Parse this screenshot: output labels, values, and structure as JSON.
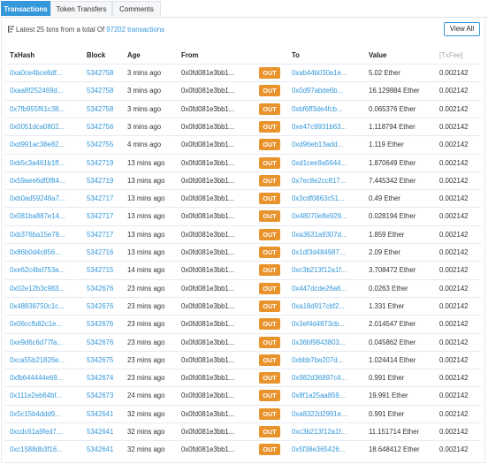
{
  "tabs": [
    {
      "label": "Transactions"
    },
    {
      "label": "Token Transfers"
    },
    {
      "label": "Comments"
    }
  ],
  "summary": {
    "prefix": "Latest 25 txns from a total Of",
    "total_link": "97202 transactions",
    "sort_icon": "sort-amount-icon"
  },
  "view_all_label": "View All",
  "columns": {
    "txhash": "TxHash",
    "block": "Block",
    "age": "Age",
    "from": "From",
    "to": "To",
    "value": "Value",
    "txfee": "[TxFee]"
  },
  "colors": {
    "accent": "#3498db",
    "out_badge": "#e8932c"
  },
  "rows": [
    {
      "hash": "0xa0ce4bce8df...",
      "block": "5342758",
      "age": "3 mins ago",
      "from": "0x0fd081e3bb1...",
      "dir": "OUT",
      "to": "0xab44b030a1e...",
      "value": "5.02 Ether",
      "fee": "0.002142"
    },
    {
      "hash": "0xaa8f252469d...",
      "block": "5342758",
      "age": "3 mins ago",
      "from": "0x0fd081e3bb1...",
      "dir": "OUT",
      "to": "0x0d97abde6b...",
      "value": "16.129884 Ether",
      "fee": "0.002142"
    },
    {
      "hash": "0x7fb955f61c38...",
      "block": "5342758",
      "age": "3 mins ago",
      "from": "0x0fd081e3bb1...",
      "dir": "OUT",
      "to": "0xbf6ff3de4fcb...",
      "value": "0.065376 Ether",
      "fee": "0.002142"
    },
    {
      "hash": "0x0051dca0802...",
      "block": "5342756",
      "age": "3 mins ago",
      "from": "0x0fd081e3bb1...",
      "dir": "OUT",
      "to": "0xe47c9931b63...",
      "value": "1.118794 Ether",
      "fee": "0.002142"
    },
    {
      "hash": "0xd991ac38e82...",
      "block": "5342755",
      "age": "4 mins ago",
      "from": "0x0fd081e3bb1...",
      "dir": "OUT",
      "to": "0xd96eb13add...",
      "value": "1.119 Ether",
      "fee": "0.002142"
    },
    {
      "hash": "0xb5c3a461b1ff...",
      "block": "5342719",
      "age": "13 mins ago",
      "from": "0x0fd081e3bb1...",
      "dir": "OUT",
      "to": "0xd1cee9a5644...",
      "value": "1.870649 Ether",
      "fee": "0.002142"
    },
    {
      "hash": "0x59aee6df0f84...",
      "block": "5342719",
      "age": "13 mins ago",
      "from": "0x0fd081e3bb1...",
      "dir": "OUT",
      "to": "0x7ec8e2cc817...",
      "value": "7.445342 Ether",
      "fee": "0.002142"
    },
    {
      "hash": "0xb0ad59248a7...",
      "block": "5342717",
      "age": "13 mins ago",
      "from": "0x0fd081e3bb1...",
      "dir": "OUT",
      "to": "0x3cdf0863c51...",
      "value": "0.49 Ether",
      "fee": "0.002142"
    },
    {
      "hash": "0x081ba887e14...",
      "block": "5342717",
      "age": "13 mins ago",
      "from": "0x0fd081e3bb1...",
      "dir": "OUT",
      "to": "0x48070e8e929...",
      "value": "0.028194 Ether",
      "fee": "0.002142"
    },
    {
      "hash": "0xb376ba15e78...",
      "block": "5342717",
      "age": "13 mins ago",
      "from": "0x0fd081e3bb1...",
      "dir": "OUT",
      "to": "0xa3631a9307d...",
      "value": "1.859 Ether",
      "fee": "0.002142"
    },
    {
      "hash": "0x86b0d4c856...",
      "block": "5342716",
      "age": "13 mins ago",
      "from": "0x0fd081e3bb1...",
      "dir": "OUT",
      "to": "0x1df3d484987...",
      "value": "2.09 Ether",
      "fee": "0.002142"
    },
    {
      "hash": "0xe62c4bd753a...",
      "block": "5342715",
      "age": "14 mins ago",
      "from": "0x0fd081e3bb1...",
      "dir": "OUT",
      "to": "0xc3b213f12a1f...",
      "value": "3.708472 Ether",
      "fee": "0.002142"
    },
    {
      "hash": "0x02e12b3c983...",
      "block": "5342676",
      "age": "23 mins ago",
      "from": "0x0fd081e3bb1...",
      "dir": "OUT",
      "to": "0x447dcde26a6...",
      "value": "0.0263 Ether",
      "fee": "0.002142"
    },
    {
      "hash": "0x48838750c1c...",
      "block": "5342676",
      "age": "23 mins ago",
      "from": "0x0fd081e3bb1...",
      "dir": "OUT",
      "to": "0xa18d917cbf2...",
      "value": "1.331 Ether",
      "fee": "0.002142"
    },
    {
      "hash": "0x06ccfb82c1e...",
      "block": "5342676",
      "age": "23 mins ago",
      "from": "0x0fd081e3bb1...",
      "dir": "OUT",
      "to": "0x3ef4d4873cb...",
      "value": "2.014547 Ether",
      "fee": "0.002142"
    },
    {
      "hash": "0xe9d6c6d77fa...",
      "block": "5342676",
      "age": "23 mins ago",
      "from": "0x0fd081e3bb1...",
      "dir": "OUT",
      "to": "0x36bf9843803...",
      "value": "0.045862 Ether",
      "fee": "0.002142"
    },
    {
      "hash": "0xca55b21826e...",
      "block": "5342675",
      "age": "23 mins ago",
      "from": "0x0fd081e3bb1...",
      "dir": "OUT",
      "to": "0xbbb7be207d...",
      "value": "1.024414 Ether",
      "fee": "0.002142"
    },
    {
      "hash": "0xfb644444e69...",
      "block": "5342674",
      "age": "23 mins ago",
      "from": "0x0fd081e3bb1...",
      "dir": "OUT",
      "to": "0x982d36897c4...",
      "value": "0.991 Ether",
      "fee": "0.002142"
    },
    {
      "hash": "0x111e2eb64bf...",
      "block": "5342673",
      "age": "24 mins ago",
      "from": "0x0fd081e3bb1...",
      "dir": "OUT",
      "to": "0x8f1a25aa859...",
      "value": "19.991 Ether",
      "fee": "0.002142"
    },
    {
      "hash": "0x5c15b4ddd9...",
      "block": "5342641",
      "age": "32 mins ago",
      "from": "0x0fd081e3bb1...",
      "dir": "OUT",
      "to": "0xa8322d2991e...",
      "value": "0.991 Ether",
      "fee": "0.002142"
    },
    {
      "hash": "0xcdc61a9fed7...",
      "block": "5342641",
      "age": "32 mins ago",
      "from": "0x0fd081e3bb1...",
      "dir": "OUT",
      "to": "0xc3b213f12a1f...",
      "value": "11.151714 Ether",
      "fee": "0.002142"
    },
    {
      "hash": "0xc1588db3f16...",
      "block": "5342641",
      "age": "32 mins ago",
      "from": "0x0fd081e3bb1...",
      "dir": "OUT",
      "to": "0x5f38e365426...",
      "value": "18.648412 Ether",
      "fee": "0.002142"
    }
  ]
}
